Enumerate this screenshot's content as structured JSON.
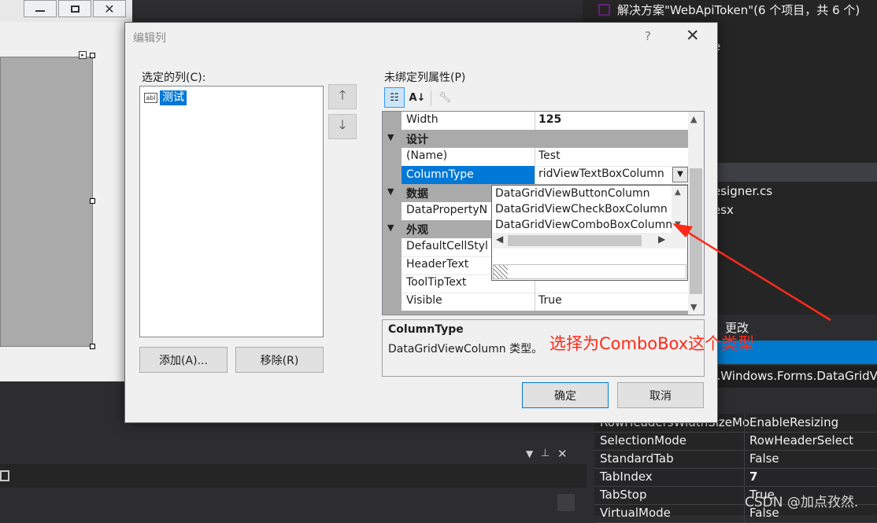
{
  "dialog": {
    "title": "编辑列",
    "help": "?",
    "close": "✕",
    "selected_columns_label": "选定的列(C):",
    "selected_column_item": "测试",
    "unbound_props_label": "未绑定列属性(P)",
    "add_button": "添加(A)...",
    "remove_button": "移除(R)",
    "ok_button": "确定",
    "cancel_button": "取消",
    "move_up": "🡑",
    "move_down": "🡓"
  },
  "property_grid": {
    "rows": [
      {
        "type": "prop",
        "name": "Width",
        "value": "125"
      },
      {
        "type": "cat",
        "name": "设计"
      },
      {
        "type": "prop",
        "name": "(Name)",
        "value": "Test"
      },
      {
        "type": "prop",
        "name": "ColumnType",
        "value": "ridViewTextBoxColumn"
      },
      {
        "type": "cat",
        "name": "数据"
      },
      {
        "type": "prop",
        "name": "DataPropertyN",
        "value": ""
      },
      {
        "type": "cat",
        "name": "外观"
      },
      {
        "type": "prop",
        "name": "DefaultCellStyl",
        "value": ""
      },
      {
        "type": "prop",
        "name": "HeaderText",
        "value": ""
      },
      {
        "type": "prop",
        "name": "ToolTipText",
        "value": ""
      },
      {
        "type": "prop",
        "name": "Visible",
        "value": "True"
      }
    ],
    "dropdown_options": [
      "DataGridViewButtonColumn",
      "DataGridViewCheckBoxColumn",
      "DataGridViewComboBoxColumn"
    ],
    "description_title": "ColumnType",
    "description_text": "DataGridViewColumn 类型。"
  },
  "annotation": {
    "text": "选择为ComboBox这个类型",
    "color": "#ff2a1a"
  },
  "background": {
    "solution_title": "解决方案\"WebApiToken\"(6 个项目，共 6 个)",
    "solution_files": [
      "e",
      "esigner.cs",
      "esx"
    ],
    "props_header": "更改",
    "props_type": "n.Windows.Forms.DataGridV",
    "props_rows": [
      {
        "name": "RowHeadersWidthSizeMo",
        "value": "EnableResizing"
      },
      {
        "name": "SelectionMode",
        "value": "RowHeaderSelect"
      },
      {
        "name": "StandardTab",
        "value": "False"
      },
      {
        "name": "TabIndex",
        "value": "7"
      },
      {
        "name": "TabStop",
        "value": "True"
      },
      {
        "name": "VirtualMode",
        "value": "False"
      }
    ],
    "watermark": "CSDN @加点孜然."
  }
}
